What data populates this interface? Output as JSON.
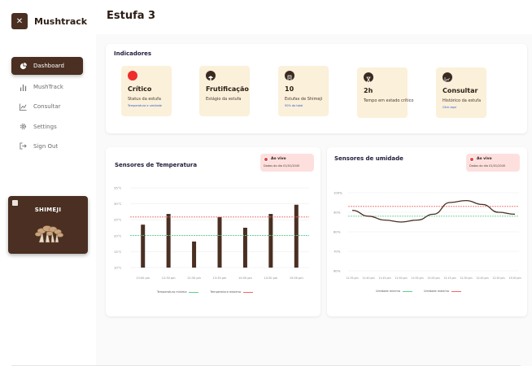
{
  "app": {
    "name": "Mushtrack"
  },
  "sidebar": {
    "items": [
      {
        "label": "Dashboard",
        "icon": "pie-chart-icon",
        "active": true
      },
      {
        "label": "MushTrack",
        "icon": "bar-chart-icon",
        "active": false
      },
      {
        "label": "Consultar",
        "icon": "line-chart-icon",
        "active": false
      },
      {
        "label": "Settings",
        "icon": "gear-icon",
        "active": false
      },
      {
        "label": "Sign Out",
        "icon": "sign-out-icon",
        "active": false
      }
    ],
    "promo": {
      "title": "SHIMEJI"
    }
  },
  "page": {
    "title": "Estufa 3"
  },
  "indicators": {
    "title": "Indicadores",
    "items": [
      {
        "main": "Crítico",
        "sub": "Status da estufa",
        "link": "Temperatura e umidade",
        "icon": "status-dot-icon",
        "color": "#ee2d2d"
      },
      {
        "main": "Frutificação",
        "sub": "Estágio da estufa",
        "link": "",
        "icon": "mushroom-icon",
        "color": "#3a2a20"
      },
      {
        "main": "10",
        "sub": "Estufas de Shimeji",
        "link": "50% do total",
        "icon": "document-icon",
        "color": "#3a2a20"
      },
      {
        "main": "2h",
        "sub": "Tempo em estado crítico",
        "link": "",
        "icon": "hourglass-icon",
        "color": "#3a2a20"
      },
      {
        "main": "Consultar",
        "sub": "Histórico da estufa",
        "link": "Click aqui",
        "icon": "chart-icon",
        "color": "#3a2a20"
      }
    ]
  },
  "temperature": {
    "title": "Sensores de Temperatura",
    "live_title": "Ao vivo",
    "live_sub": "Dados do dia 01/01/2045",
    "legend": {
      "min": "Temperatura mínima",
      "max": "Temperatura máxima"
    }
  },
  "humidity": {
    "title": "Sensores de umidade",
    "live_title": "Ao vivo",
    "live_sub": "Dados do dia 01/01/2045",
    "legend": {
      "min": "Umidade mínima",
      "max": "Umidade máxima"
    }
  },
  "colors": {
    "brown": "#4a2f22",
    "min_line": "#62d08f",
    "max_line": "#ee6a6a",
    "card_bg": "#fbf0d9"
  },
  "chart_data": [
    {
      "type": "bar",
      "title": "Sensores de Temperatura",
      "categories": [
        "13:00 pm",
        "12:30 pm",
        "12:30 pm",
        "13:30 pm",
        "14:00 pm",
        "14:30 pm",
        "15:00 pm"
      ],
      "values": [
        28,
        35,
        17,
        33,
        26,
        35,
        41
      ],
      "y_ticks": [
        "10°C",
        "15°C",
        "20°C",
        "25°C",
        "30°C",
        "35°C"
      ],
      "ylim": [
        0,
        52
      ],
      "min_line": 21,
      "max_line": 33,
      "legend": [
        "Temperatura mínima",
        "Temperatura máxima"
      ],
      "grid": true
    },
    {
      "type": "line",
      "title": "Sensores de umidade",
      "x": [
        "11:35 pm",
        "11:40 pm",
        "11:45 pm",
        "11:50 pm",
        "11:55 pm",
        "12:00 pm",
        "12:15 pm",
        "12:30 pm",
        "12:45 pm",
        "12:50 pm",
        "13:00 pm"
      ],
      "values": [
        91,
        88,
        86,
        85,
        86,
        89,
        95,
        96,
        94,
        90,
        89
      ],
      "y_ticks": [
        "60%",
        "70%",
        "80%",
        "90%",
        "100%"
      ],
      "ylim": [
        60,
        100
      ],
      "min_line": 88,
      "max_line": 93,
      "legend": [
        "Umidade mínima",
        "Umidade máxima"
      ],
      "grid": true
    }
  ]
}
